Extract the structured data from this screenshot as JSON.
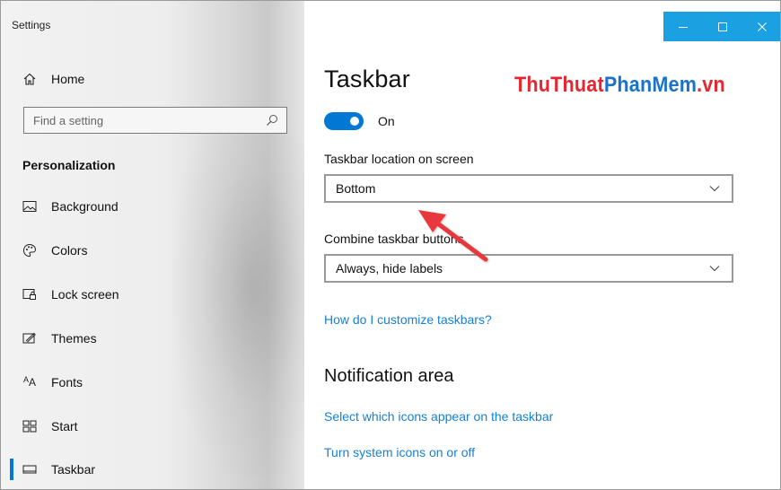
{
  "window": {
    "app_title": "Settings",
    "controls": {
      "minimize": "–",
      "maximize": "☐",
      "close": "✕"
    },
    "accent_color": "#1ba1e2"
  },
  "sidebar": {
    "home_label": "Home",
    "search": {
      "placeholder": "Find a setting",
      "icon": "search-icon"
    },
    "section_header": "Personalization",
    "items": [
      {
        "label": "Background",
        "icon": "picture-icon"
      },
      {
        "label": "Colors",
        "icon": "palette-icon"
      },
      {
        "label": "Lock screen",
        "icon": "lock-screen-icon"
      },
      {
        "label": "Themes",
        "icon": "themes-icon"
      },
      {
        "label": "Fonts",
        "icon": "fonts-icon",
        "icon_text": "AA"
      },
      {
        "label": "Start",
        "icon": "start-icon"
      },
      {
        "label": "Taskbar",
        "icon": "taskbar-icon",
        "active": true
      }
    ],
    "active_indicator_color": "#0078d4"
  },
  "main": {
    "title": "Taskbar",
    "watermark": {
      "part1": "ThuThuat",
      "part2": "PhanMem",
      "part3": ".vn",
      "color1": "#e8262f",
      "color2": "#1a73c8"
    },
    "toggle": {
      "state_label": "On",
      "on": true,
      "color": "#0078d4"
    },
    "location": {
      "label": "Taskbar location on screen",
      "value": "Bottom"
    },
    "combine": {
      "label": "Combine taskbar buttons",
      "value": "Always, hide labels"
    },
    "help_link": "How do I customize taskbars?",
    "notification": {
      "title": "Notification area",
      "links": [
        "Select which icons appear on the taskbar",
        "Turn system icons on or off"
      ]
    },
    "link_color": "#1680d6",
    "annotation_arrow_color": "#e8383d"
  }
}
